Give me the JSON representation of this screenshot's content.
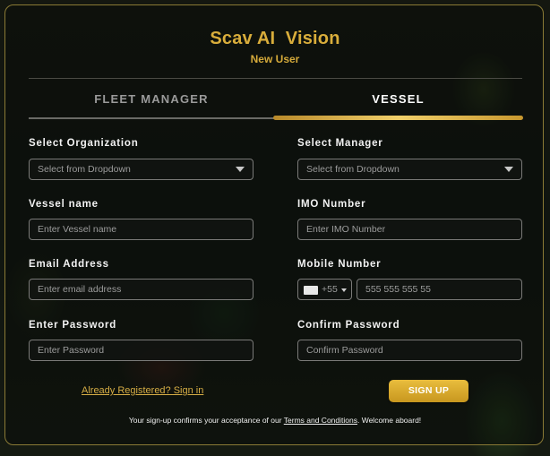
{
  "header": {
    "title": "Scav AI  Vision",
    "subtitle": "New User"
  },
  "tabs": [
    {
      "label": "FLEET MANAGER",
      "active": false
    },
    {
      "label": "VESSEL",
      "active": true
    }
  ],
  "form": {
    "organization": {
      "label": "Select Organization",
      "placeholder": "Select from Dropdown"
    },
    "manager": {
      "label": "Select Manager",
      "placeholder": "Select from Dropdown"
    },
    "vessel_name": {
      "label": "Vessel name",
      "placeholder": "Enter Vessel name"
    },
    "imo_number": {
      "label": "IMO Number",
      "placeholder": "Enter IMO Number"
    },
    "email": {
      "label": "Email Address",
      "placeholder": "Enter email address"
    },
    "mobile": {
      "label": "Mobile Number",
      "country_code": "+55",
      "placeholder": "555 555 555 55"
    },
    "password": {
      "label": "Enter Password",
      "placeholder": "Enter Password"
    },
    "confirm_password": {
      "label": "Confirm Password",
      "placeholder": "Confirm Password"
    }
  },
  "actions": {
    "signin_link": "Already Registered? Sign in",
    "signup_button": "SIGN UP"
  },
  "footer": {
    "prefix": "Your sign-up confirms your acceptance of our ",
    "terms_link": "Terms and Conditions",
    "suffix": ". Welcome aboard!"
  },
  "colors": {
    "accent_gold": "#d9ad3b",
    "button_gold": "#e9bd3d",
    "panel_border": "#8a7a35"
  },
  "icons": {
    "dropdown": "caret-down-icon",
    "flag": "country-flag-icon"
  }
}
